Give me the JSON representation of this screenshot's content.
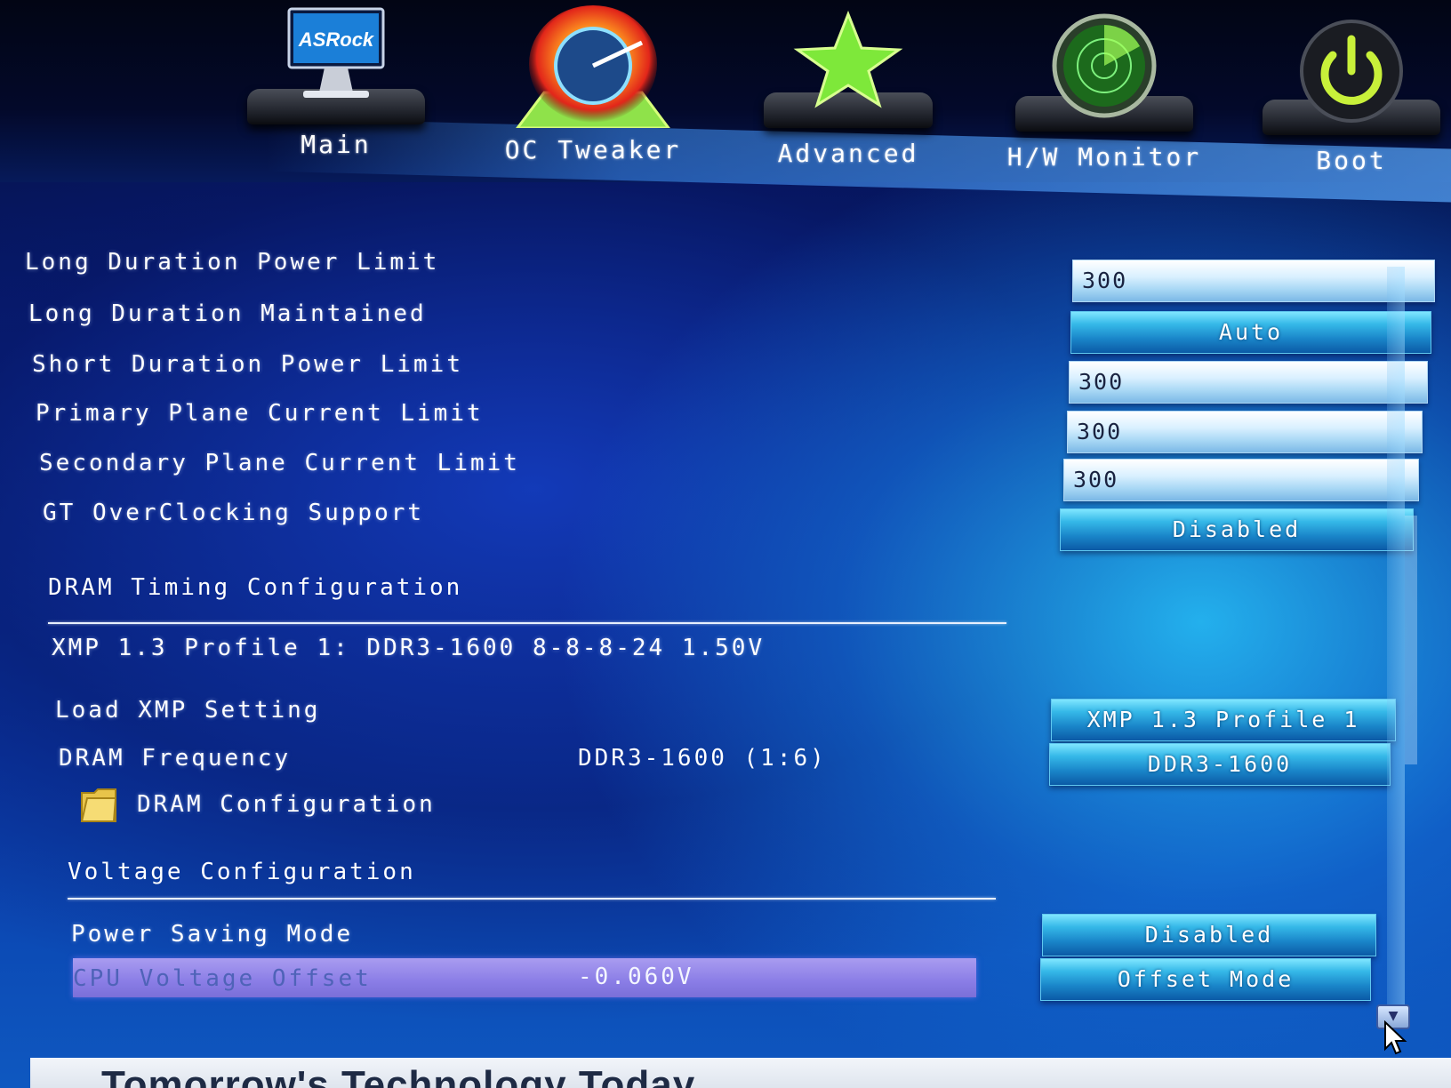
{
  "nav": {
    "items": [
      {
        "label": "Main",
        "icon": "monitor-icon",
        "logo_text": "ASRock"
      },
      {
        "label": "OC Tweaker",
        "icon": "speedometer-flame-icon"
      },
      {
        "label": "Advanced",
        "icon": "star-icon"
      },
      {
        "label": "H/W Monitor",
        "icon": "radar-icon"
      },
      {
        "label": "Boot",
        "icon": "power-icon"
      }
    ]
  },
  "settings": {
    "long_duration_power_limit": {
      "label": "Long Duration Power Limit",
      "value": "300"
    },
    "long_duration_maintained": {
      "label": "Long Duration Maintained",
      "value": "Auto"
    },
    "short_duration_power_limit": {
      "label": "Short Duration Power Limit",
      "value": "300"
    },
    "primary_plane_current_limit": {
      "label": "Primary Plane Current Limit",
      "value": "300"
    },
    "secondary_plane_current_limit": {
      "label": "Secondary Plane Current Limit",
      "value": "300"
    },
    "gt_overclocking_support": {
      "label": "GT OverClocking Support",
      "value": "Disabled"
    }
  },
  "dram": {
    "section_title": "DRAM Timing Configuration",
    "xmp_profile_info": "XMP 1.3 Profile 1: DDR3-1600 8-8-8-24 1.50V",
    "load_xmp_setting": {
      "label": "Load XMP Setting",
      "value": "XMP 1.3 Profile 1"
    },
    "dram_frequency": {
      "label": "DRAM Frequency",
      "current": "DDR3-1600 (1:6)",
      "value": "DDR3-1600"
    },
    "dram_configuration": {
      "label": "DRAM Configuration",
      "icon": "folder-icon"
    }
  },
  "voltage": {
    "section_title": "Voltage Configuration",
    "power_saving_mode": {
      "label": "Power Saving Mode",
      "value": "Disabled"
    },
    "cpu_voltage_offset": {
      "label": "CPU Voltage Offset",
      "current": "-0.060V",
      "value": "Offset Mode"
    }
  },
  "footer": {
    "slogan": "Tomorrow's Technology Today"
  },
  "colors": {
    "highlight": "#8a7de6",
    "select_button": "#1a86c9",
    "input_field": "#d9f0ff",
    "background_dark": "#030a2c",
    "background_light": "#35b8e8"
  }
}
